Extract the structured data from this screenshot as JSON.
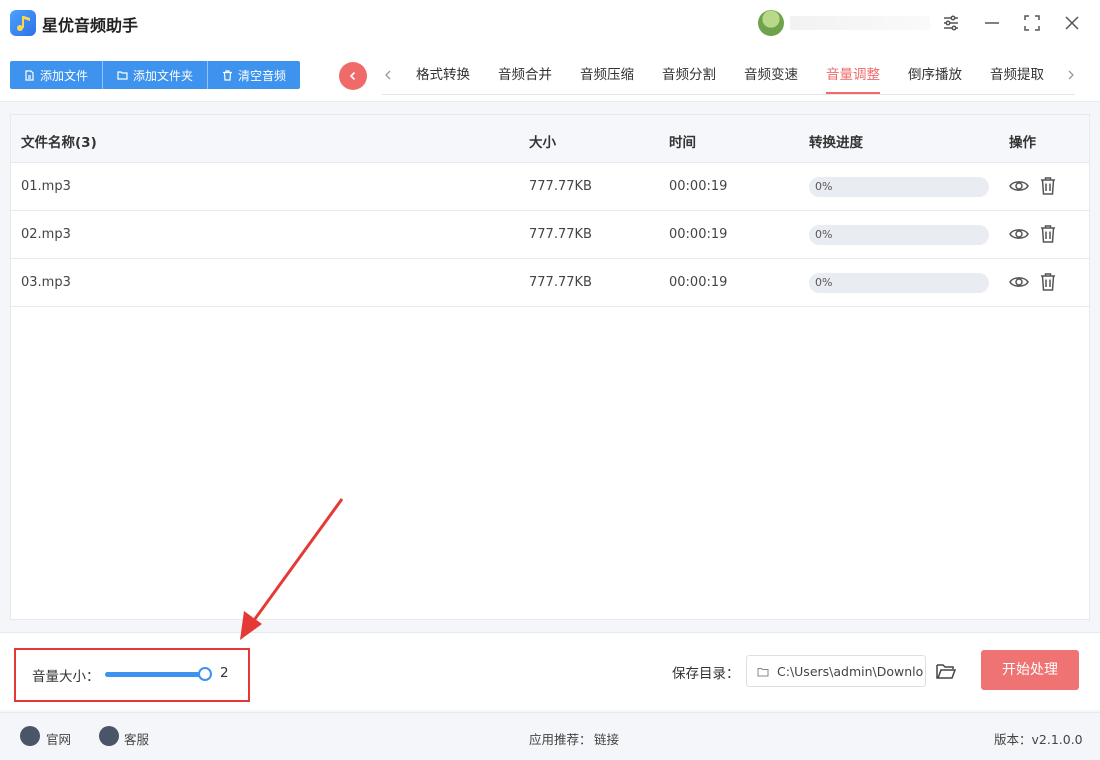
{
  "app": {
    "title": "星优音频助手"
  },
  "toolbar": {
    "buttons": [
      {
        "label": "添加文件",
        "icon": "file-icon"
      },
      {
        "label": "添加文件夹",
        "icon": "folder-icon"
      },
      {
        "label": "清空音频",
        "icon": "trash-icon"
      }
    ]
  },
  "tabs": [
    {
      "label": "格式转换",
      "active": false
    },
    {
      "label": "音频合并",
      "active": false
    },
    {
      "label": "音频压缩",
      "active": false
    },
    {
      "label": "音频分割",
      "active": false
    },
    {
      "label": "音频变速",
      "active": false
    },
    {
      "label": "音量调整",
      "active": true
    },
    {
      "label": "倒序播放",
      "active": false
    },
    {
      "label": "音频提取",
      "active": false
    }
  ],
  "table": {
    "headers": {
      "name": "文件名称(3)",
      "size": "大小",
      "time": "时间",
      "progress": "转换进度",
      "actions": "操作"
    },
    "rows": [
      {
        "name": "01.mp3",
        "size": "777.77KB",
        "time": "00:00:19",
        "progress": "0%",
        "progress_value": 0
      },
      {
        "name": "02.mp3",
        "size": "777.77KB",
        "time": "00:00:19",
        "progress": "0%",
        "progress_value": 0
      },
      {
        "name": "03.mp3",
        "size": "777.77KB",
        "time": "00:00:19",
        "progress": "0%",
        "progress_value": 0
      }
    ]
  },
  "settings": {
    "volume_label": "音量大小：",
    "volume_value": "2",
    "volume_fraction": 1.0,
    "save_label": "保存目录：",
    "save_path": "C:\\Users\\admin\\Downlo",
    "start_label": "开始处理"
  },
  "footer": {
    "official": "官网",
    "support": "客服",
    "recommend_label": "应用推荐：",
    "recommend_link": "链接",
    "version": "版本：v2.1.0.0"
  },
  "colors": {
    "accent": "#3d93ee",
    "active_tab": "#f06a6a",
    "start_button": "#f07373",
    "annotation": "#e53935"
  }
}
